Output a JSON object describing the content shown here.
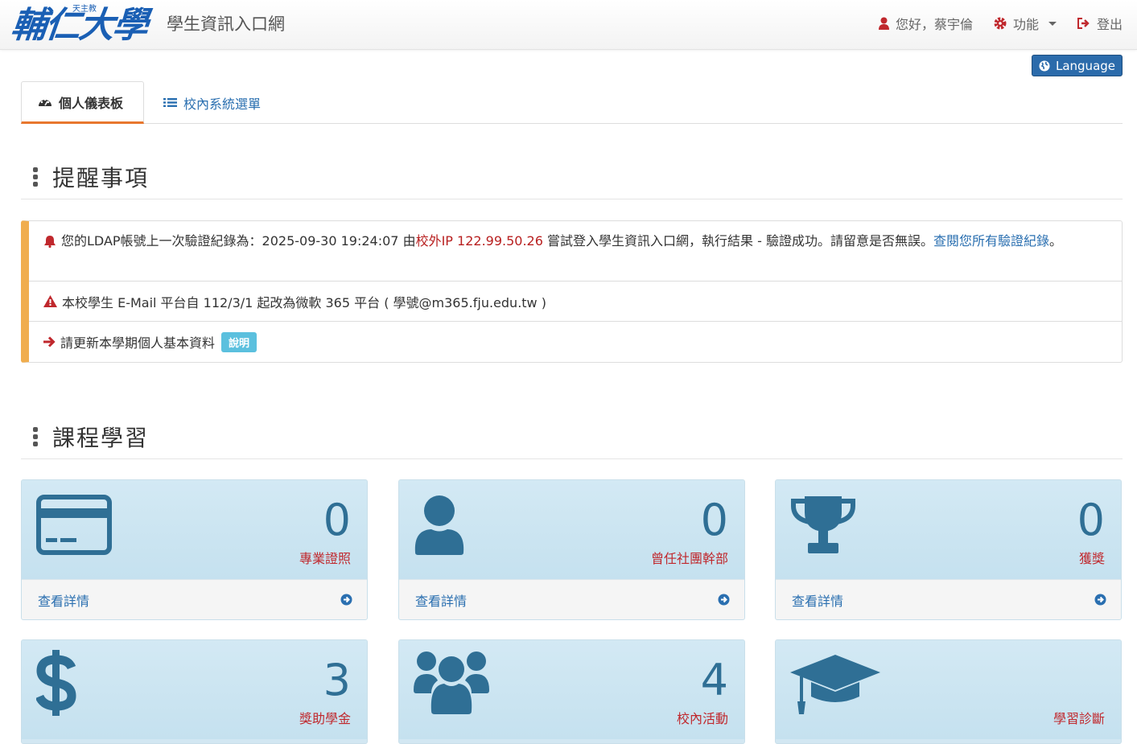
{
  "header": {
    "logo_text": "輔仁大學",
    "logo_small": "天主教",
    "site_title": "學生資訊入口網",
    "greeting": "您好，蔡宇倫",
    "functions_label": "功能",
    "logout_label": "登出"
  },
  "language_button": "Language",
  "tabs": [
    {
      "label": "個人儀表板",
      "icon": "dashboard-icon",
      "active": true
    },
    {
      "label": "校內系統選單",
      "icon": "list-icon",
      "active": false
    }
  ],
  "reminders": {
    "title": "提醒事項",
    "n1": {
      "prefix": "您的LDAP帳號上一次驗證紀錄為：2025-09-30 19:24:07 由",
      "location": "校外IP 122.99.50.26",
      "suffix": " 嘗試登入學生資訊入口網，執行結果 - 驗證成功。請留意是否無誤。",
      "link": "查閱您所有驗證紀錄",
      "end": "。"
    },
    "n2": "本校學生 E-Mail 平台自 112/3/1 起改為微軟 365 平台 ( 學號@m365.fju.edu.tw )",
    "n3": {
      "text": "請更新本學期個人基本資料",
      "badge": "說明"
    }
  },
  "courses": {
    "title": "課程學習",
    "cards": [
      {
        "value": "0",
        "label": "專業證照",
        "footer": "查看詳情",
        "icon": "credit-card-icon"
      },
      {
        "value": "0",
        "label": "曾任社團幹部",
        "footer": "查看詳情",
        "icon": "user-icon"
      },
      {
        "value": "0",
        "label": "獲獎",
        "footer": "查看詳情",
        "icon": "trophy-icon"
      },
      {
        "value": "3",
        "label": "獎助學金",
        "icon": "dollar-icon"
      },
      {
        "value": "4",
        "label": "校內活動",
        "icon": "users-icon"
      },
      {
        "value": "",
        "label": "學習診斷",
        "icon": "graduation-cap-icon"
      }
    ]
  },
  "colors": {
    "accent": "#e8772e",
    "primary": "#2b6bab",
    "warning": "#f0ad4e",
    "card_bg": "#d2e7f2",
    "value": "#2f6f95",
    "label_red": "#c0282d"
  }
}
